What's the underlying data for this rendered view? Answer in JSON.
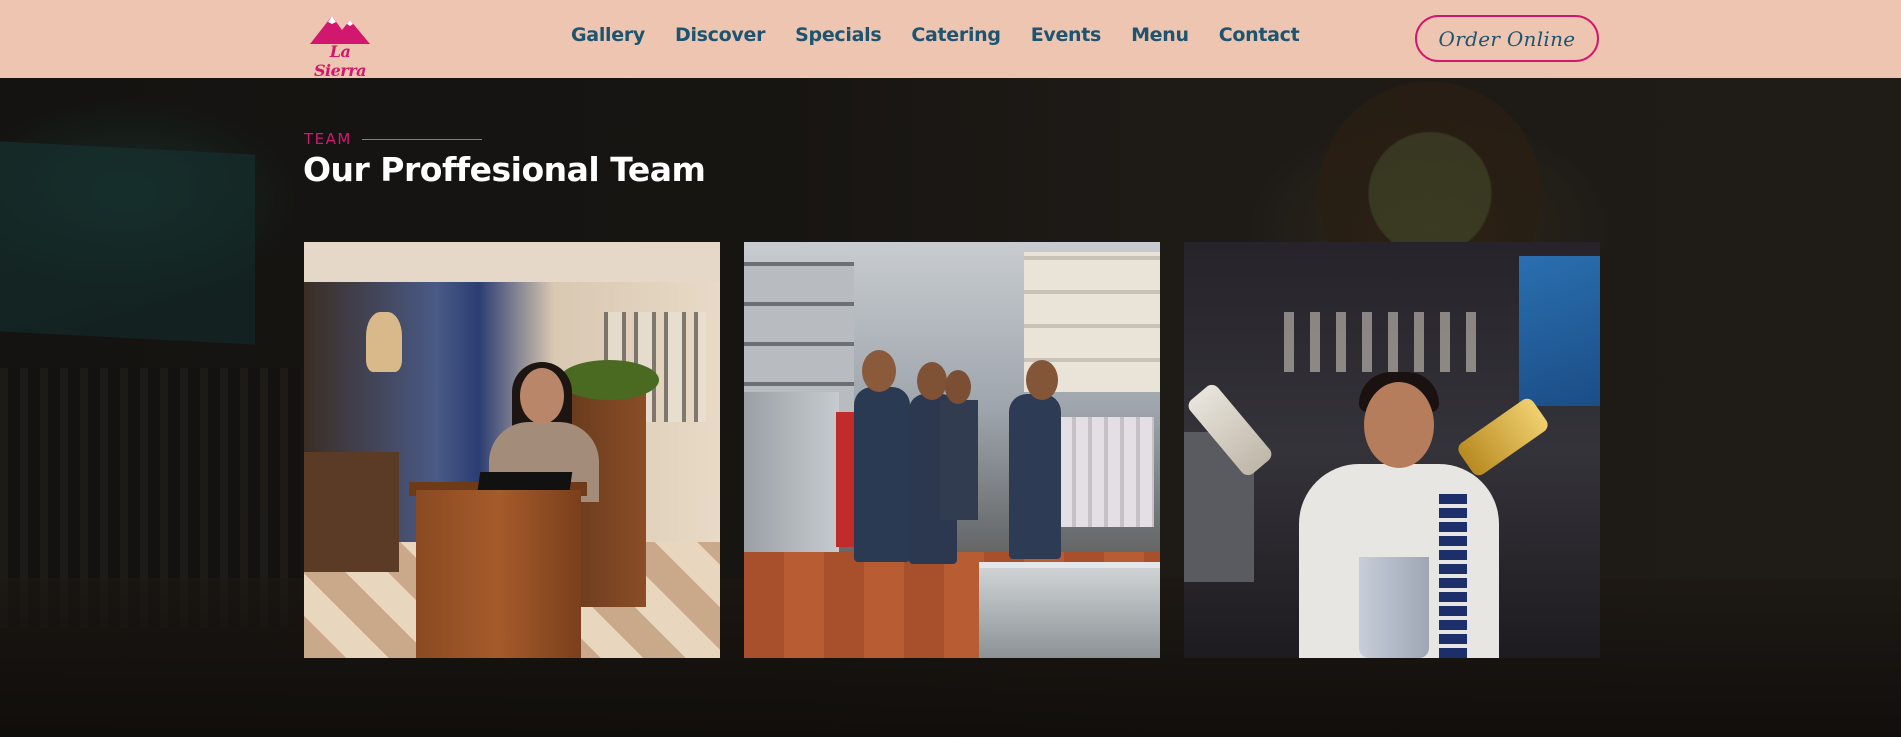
{
  "header": {
    "logo": {
      "alt": "La Sierra",
      "text": "La Sierra",
      "color": "#d1186e"
    },
    "nav": [
      {
        "label": "Gallery"
      },
      {
        "label": "Discover"
      },
      {
        "label": "Specials"
      },
      {
        "label": "Catering"
      },
      {
        "label": "Events"
      },
      {
        "label": "Menu"
      },
      {
        "label": "Contact"
      }
    ],
    "order_button": "Order Online",
    "background_color": "#eec5b0",
    "accent_color": "#d1186e",
    "nav_color": "#1d5470"
  },
  "team_section": {
    "eyebrow": "TEAM",
    "title": "Our Proffesional Team",
    "cards": [
      {
        "photo": "host-at-podium"
      },
      {
        "photo": "kitchen-staff"
      },
      {
        "photo": "bartender-pouring"
      }
    ]
  }
}
